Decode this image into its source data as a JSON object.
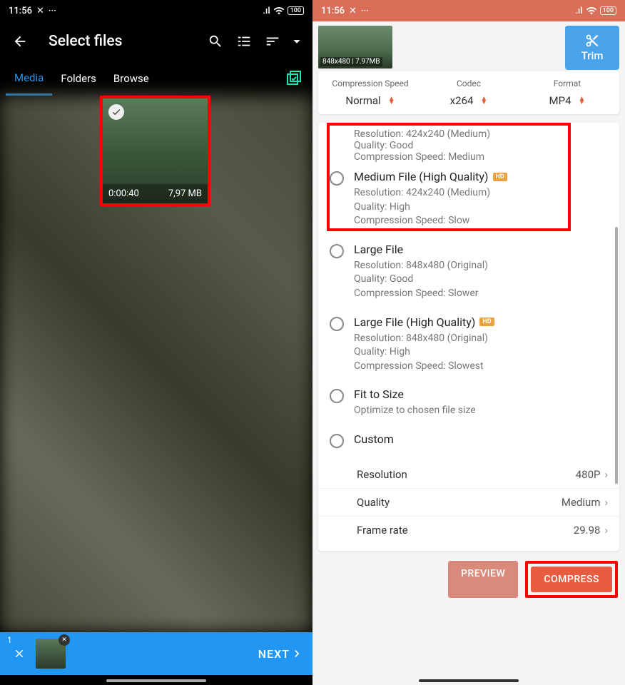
{
  "left": {
    "status": {
      "time": "11:56",
      "battery": "100"
    },
    "title": "Select files",
    "tabs": [
      "Media",
      "Folders",
      "Browse"
    ],
    "selected": {
      "duration": "0:00:40",
      "size": "7,97 MB"
    },
    "bottom": {
      "count": "1",
      "next": "NEXT"
    }
  },
  "right": {
    "status": {
      "time": "11:56",
      "battery": "100"
    },
    "thumb_label": "848x480 | 7.97MB",
    "trim": "Trim",
    "settings": {
      "speed": {
        "label": "Compression Speed",
        "value": "Normal"
      },
      "codec": {
        "label": "Codec",
        "value": "x264"
      },
      "format": {
        "label": "Format",
        "value": "MP4"
      }
    },
    "partial": {
      "res": "Resolution: 424x240 (Medium)",
      "quality": "Quality: Good",
      "speed": "Compression Speed: Medium"
    },
    "options": [
      {
        "title": "Medium File (High Quality)",
        "hd": true,
        "desc": "Resolution: 424x240 (Medium)\nQuality: High\nCompression Speed: Slow"
      },
      {
        "title": "Large File",
        "hd": false,
        "desc": "Resolution: 848x480 (Original)\nQuality: Good\nCompression Speed: Slower"
      },
      {
        "title": "Large File (High Quality)",
        "hd": true,
        "desc": "Resolution: 848x480 (Original)\nQuality: High\nCompression Speed: Slowest"
      },
      {
        "title": "Fit to Size",
        "hd": false,
        "desc": "Optimize to chosen file size"
      },
      {
        "title": "Custom",
        "hd": false,
        "desc": ""
      }
    ],
    "custom": {
      "resolution": {
        "label": "Resolution",
        "value": "480P"
      },
      "quality": {
        "label": "Quality",
        "value": "Medium"
      },
      "framerate": {
        "label": "Frame rate",
        "value": "29.98"
      }
    },
    "actions": {
      "preview": "PREVIEW",
      "compress": "COMPRESS"
    }
  }
}
